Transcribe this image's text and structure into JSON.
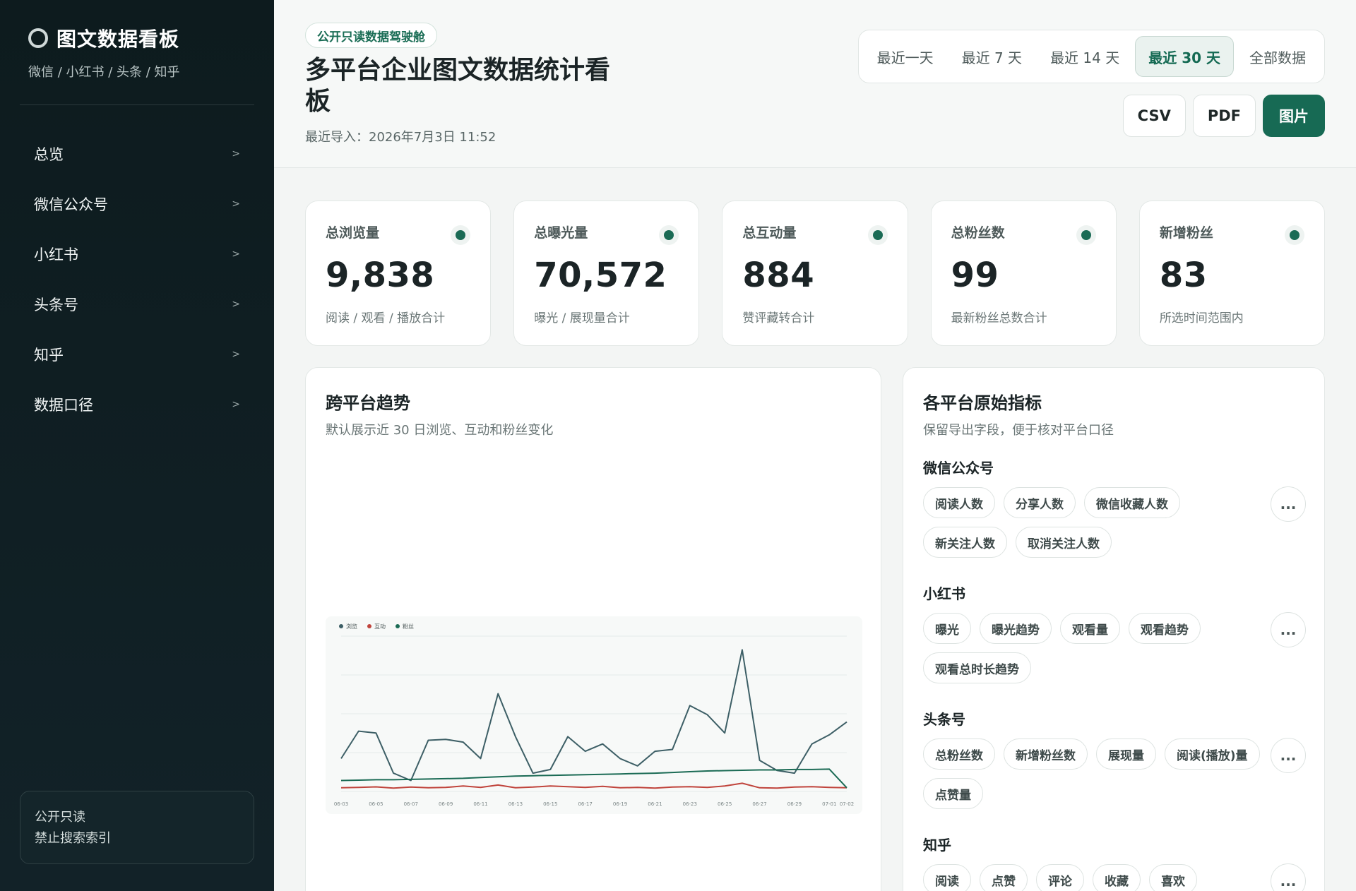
{
  "sidebar": {
    "brand_title": "图文数据看板",
    "brand_sub": "微信 / 小红书 / 头条 / 知乎",
    "items": [
      {
        "label": "总览"
      },
      {
        "label": "微信公众号"
      },
      {
        "label": "小红书"
      },
      {
        "label": "头条号"
      },
      {
        "label": "知乎"
      },
      {
        "label": "数据口径"
      }
    ],
    "chevron": ">",
    "footer_line1": "公开只读",
    "footer_line2": "禁止搜索索引"
  },
  "header": {
    "tag": "公开只读数据驾驶舱",
    "title": "多平台企业图文数据统计看板",
    "import_time": "最近导入：2026年7月3日 11:52",
    "ranges": [
      "最近一天",
      "最近 7 天",
      "最近 14 天",
      "最近 30 天",
      "全部数据"
    ],
    "active_range": "最近 30 天",
    "exports": [
      "CSV",
      "PDF",
      "图片"
    ]
  },
  "kpis": [
    {
      "label": "总浏览量",
      "value": "9,838",
      "note": "阅读 / 观看 / 播放合计"
    },
    {
      "label": "总曝光量",
      "value": "70,572",
      "note": "曝光 / 展现量合计"
    },
    {
      "label": "总互动量",
      "value": "884",
      "note": "赞评藏转合计"
    },
    {
      "label": "总粉丝数",
      "value": "99",
      "note": "最新粉丝总数合计"
    },
    {
      "label": "新增粉丝",
      "value": "83",
      "note": "所选时间范围内"
    }
  ],
  "trend": {
    "title": "跨平台趋势",
    "subtitle": "默认展示近 30 日浏览、互动和粉丝变化"
  },
  "metrics": {
    "title": "各平台原始指标",
    "subtitle": "保留导出字段，便于核对平台口径",
    "more": "...",
    "platforms": [
      {
        "name": "微信公众号",
        "chips": [
          "阅读人数",
          "分享人数",
          "微信收藏人数",
          "新关注人数",
          "取消关注人数"
        ]
      },
      {
        "name": "小红书",
        "chips": [
          "曝光",
          "曝光趋势",
          "观看量",
          "观看趋势",
          "观看总时长趋势"
        ]
      },
      {
        "name": "头条号",
        "chips": [
          "总粉丝数",
          "新增粉丝数",
          "展现量",
          "阅读(播放)量",
          "点赞量"
        ]
      },
      {
        "name": "知乎",
        "chips": [
          "阅读",
          "点赞",
          "评论",
          "收藏",
          "喜欢"
        ]
      }
    ]
  },
  "chart_data": {
    "type": "line",
    "x": [
      "06-03",
      "06-04",
      "06-05",
      "06-06",
      "06-07",
      "06-08",
      "06-09",
      "06-10",
      "06-11",
      "06-12",
      "06-13",
      "06-14",
      "06-15",
      "06-16",
      "06-17",
      "06-18",
      "06-19",
      "06-20",
      "06-21",
      "06-22",
      "06-23",
      "06-24",
      "06-25",
      "06-26",
      "06-27",
      "06-28",
      "06-29",
      "06-30",
      "07-01",
      "07-02"
    ],
    "xticks": [
      "06-03",
      "06-05",
      "06-07",
      "06-09",
      "06-11",
      "06-13",
      "06-15",
      "06-17",
      "06-19",
      "06-21",
      "06-23",
      "06-25",
      "06-27",
      "06-29",
      "07-01",
      "07-02"
    ],
    "series": [
      {
        "name": "浏览",
        "color": "#3d5f66",
        "values": [
          180,
          330,
          320,
          100,
          60,
          280,
          285,
          270,
          180,
          535,
          300,
          100,
          120,
          300,
          220,
          260,
          180,
          140,
          220,
          230,
          470,
          420,
          320,
          775,
          170,
          115,
          100,
          260,
          310,
          380
        ]
      },
      {
        "name": "互动",
        "color": "#c0443c",
        "values": [
          20,
          22,
          25,
          18,
          24,
          20,
          22,
          30,
          22,
          35,
          20,
          24,
          30,
          26,
          22,
          28,
          20,
          22,
          18,
          24,
          26,
          22,
          30,
          45,
          20,
          18,
          24,
          26,
          22,
          20
        ]
      },
      {
        "name": "粉丝",
        "color": "#1b6b55",
        "values": [
          60,
          62,
          64,
          64,
          66,
          68,
          70,
          72,
          76,
          80,
          84,
          86,
          88,
          90,
          92,
          94,
          96,
          98,
          100,
          104,
          108,
          112,
          114,
          116,
          118,
          118,
          120,
          120,
          122,
          20
        ]
      }
    ],
    "ylim": [
      0,
      850
    ],
    "legend": "top-left",
    "grid": true
  }
}
